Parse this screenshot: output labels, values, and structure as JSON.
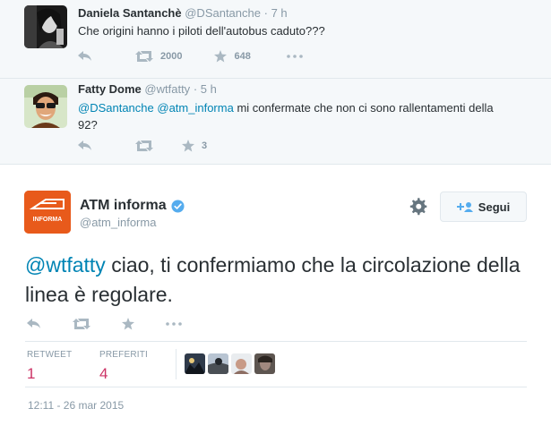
{
  "tweet1": {
    "name": "Daniela Santanchè",
    "screen_name": "@DSantanche",
    "dot": "·",
    "time": "7 h",
    "text": "Che origini hanno i piloti dell'autobus caduto???",
    "retweets": "2000",
    "favorites": "648"
  },
  "tweet2": {
    "name": "Fatty Dome",
    "screen_name": "@wtfatty",
    "dot": "·",
    "time": "5 h",
    "mention1": "@DSantanche",
    "mention2": "@atm_informa",
    "text_rest": " mi confermate che non ci sono rallentamenti della 92?",
    "favorites": "3"
  },
  "main": {
    "name": "ATM informa",
    "screen_name": "@atm_informa",
    "avatar_label": "INFORMA",
    "follow_label": "Segui",
    "mention": "@wtfatty",
    "text_rest": " ciao, ti confermiamo che la circolazione della linea è regolare.",
    "stats": {
      "retweet_label": "RETWEET",
      "retweet_count": "1",
      "favorite_label": "PREFERITI",
      "favorite_count": "4"
    },
    "date": "12:11 - 26 mar 2015"
  },
  "colors": {
    "link": "#0084b4",
    "stat_value": "#cc3366",
    "atm_orange": "#e85a1b",
    "verified": "#55acee"
  },
  "icons": [
    "reply-icon",
    "retweet-icon",
    "favorite-icon",
    "more-icon",
    "gear-icon",
    "follow-person-icon",
    "verified-icon"
  ]
}
